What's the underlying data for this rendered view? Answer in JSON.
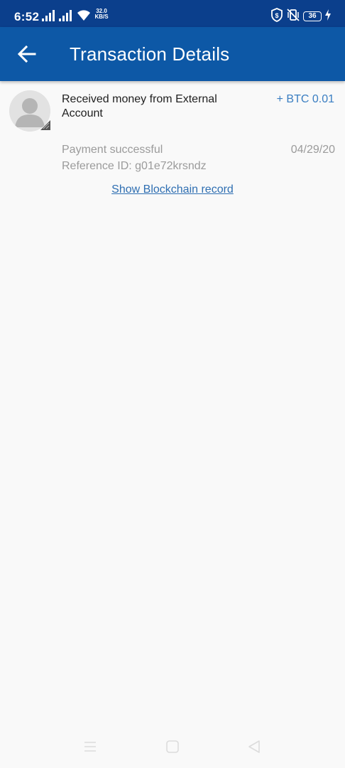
{
  "status_bar": {
    "time": "6:52",
    "net_speed_value": "32.0",
    "net_speed_unit": "KB/S",
    "battery": "36"
  },
  "app_bar": {
    "title": "Transaction Details",
    "back_icon": "arrow-back-icon"
  },
  "transaction": {
    "title": "Received money from External Account",
    "amount": "+ BTC 0.01",
    "status": "Payment successful",
    "date": "04/29/20",
    "reference": "Reference ID: g01e72krsndz",
    "blockchain_link": "Show Blockchain record"
  },
  "colors": {
    "status_bar": "#0b3f8c",
    "app_bar": "#0d58a6",
    "amount": "#3a7ec2",
    "link": "#2f6fb2",
    "muted_text": "#9b9b9b",
    "background": "#f9f9f9"
  },
  "nav_bar": {
    "icons": [
      "menu-icon",
      "home-icon",
      "back-triangle-icon"
    ]
  }
}
